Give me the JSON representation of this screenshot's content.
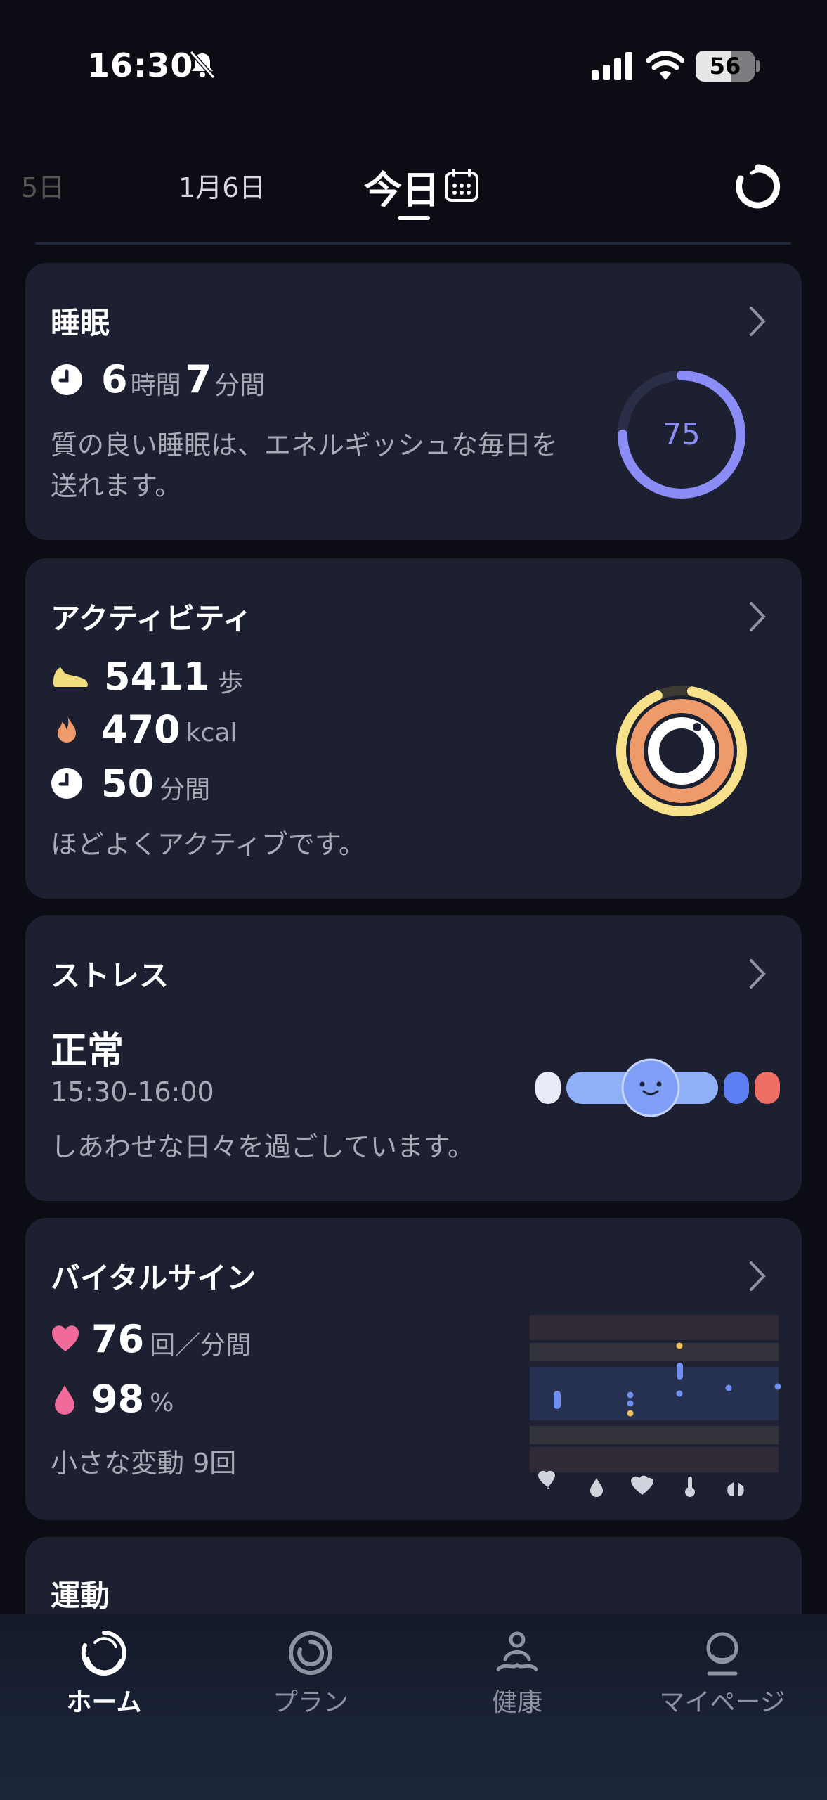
{
  "status_bar": {
    "time": "16:30",
    "battery": "56"
  },
  "date_nav": {
    "prev": "5日",
    "mid": "1月6日",
    "today": "今日"
  },
  "sleep": {
    "title": "睡眠",
    "hours": "6",
    "hours_unit": "時間",
    "minutes": "7",
    "minutes_unit": "分間",
    "desc_line1": "質の良い睡眠は、エネルギッシュな毎日を",
    "desc_line2": "送れます。",
    "score": "75",
    "score_fraction": 0.75
  },
  "activity": {
    "title": "アクティビティ",
    "steps": "5411",
    "steps_unit": "歩",
    "kcal": "470",
    "kcal_unit": "kcal",
    "minutes": "50",
    "minutes_unit": "分間",
    "desc": "ほどよくアクティブです。"
  },
  "stress": {
    "title": "ストレス",
    "level": "正常",
    "time_range": "15:30-16:00",
    "desc": "しあわせな日々を過ごしています。"
  },
  "vitals": {
    "title": "バイタルサイン",
    "heart_rate": "76",
    "heart_rate_unit": "回／分間",
    "spo2": "98",
    "spo2_unit": "%",
    "desc": "小さな変動 9回"
  },
  "exercise": {
    "title": "運動"
  },
  "nav": {
    "home": "ホーム",
    "plan": "プラン",
    "health": "健康",
    "mypage": "マイページ"
  },
  "colors": {
    "card_bg": "#1c2030",
    "sleep_ring": "#8b8cf5",
    "activity_outer": "#f7e08a",
    "activity_mid": "#ee9a6a",
    "activity_inner": "#ffffff",
    "heart": "#f06a9a"
  }
}
